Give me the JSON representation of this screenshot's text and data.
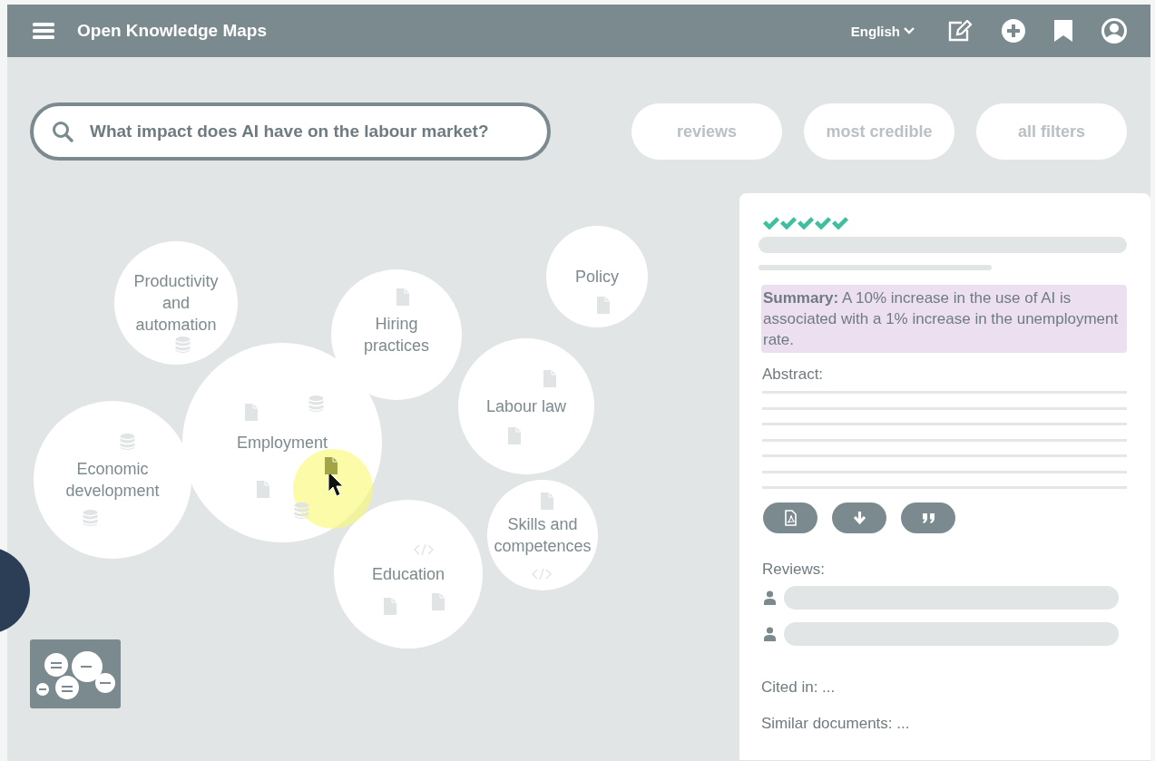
{
  "header": {
    "title": "Open Knowledge Maps",
    "language": "English"
  },
  "search": {
    "value": "What impact does AI have on the labour market?"
  },
  "filters": [
    {
      "label": "reviews",
      "disabled": true
    },
    {
      "label": "most credible",
      "disabled": true
    },
    {
      "label": "all filters",
      "disabled": true
    }
  ],
  "map": {
    "bubbles": [
      {
        "label": "Productivity and automation",
        "icons": [
          {
            "kind": "database",
            "selected": false
          }
        ]
      },
      {
        "label": "Policy",
        "icons": [
          {
            "kind": "document",
            "selected": false
          }
        ]
      },
      {
        "label": "Hiring practices",
        "icons": [
          {
            "kind": "document",
            "selected": false
          }
        ]
      },
      {
        "label": "Employment",
        "icons": [
          {
            "kind": "document",
            "selected": false
          },
          {
            "kind": "database",
            "selected": false
          },
          {
            "kind": "document",
            "selected": false
          },
          {
            "kind": "database",
            "selected": false
          },
          {
            "kind": "document",
            "selected": true
          }
        ]
      },
      {
        "label": "Labour law",
        "icons": [
          {
            "kind": "document",
            "selected": false
          },
          {
            "kind": "document",
            "selected": false
          }
        ]
      },
      {
        "label": "Economic development",
        "icons": [
          {
            "kind": "database",
            "selected": false
          },
          {
            "kind": "database",
            "selected": false
          }
        ]
      },
      {
        "label": "Skills and competences",
        "icons": [
          {
            "kind": "document",
            "selected": false
          },
          {
            "kind": "code",
            "selected": false
          }
        ]
      },
      {
        "label": "Education",
        "icons": [
          {
            "kind": "code",
            "selected": false
          },
          {
            "kind": "document",
            "selected": false
          },
          {
            "kind": "document",
            "selected": false
          }
        ]
      }
    ]
  },
  "panel": {
    "rating": [
      {
        "checked": true
      },
      {
        "checked": true
      },
      {
        "checked": true
      },
      {
        "checked": true
      },
      {
        "checked": true
      }
    ],
    "summary": "**Summary:** A 10% increase in the use of AI is associated with a 1% increase in the unemployment rate.",
    "abstract_label": "Abstract:",
    "actions": [
      {
        "kind": "pdf"
      },
      {
        "kind": "download"
      },
      {
        "kind": "cite"
      }
    ],
    "reviews_label": "Reviews:",
    "cited_in": "Cited in: ...",
    "similar": "Similar documents: ..."
  }
}
